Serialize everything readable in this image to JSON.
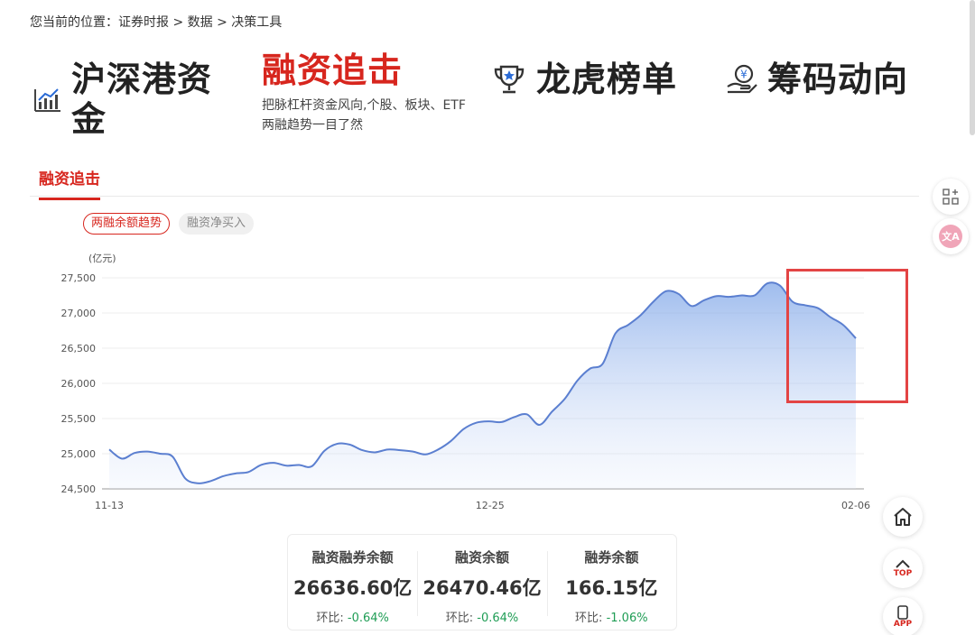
{
  "breadcrumb": "您当前的位置：证券时报 > 数据 > 决策工具",
  "tools": {
    "hk": {
      "title": "沪深港资金",
      "icon": "bar-line-icon"
    },
    "margin": {
      "title": "融资追击",
      "desc": "把脉杠杆资金风向,个股、板块、ETF两融趋势一目了然",
      "color": "#d7261e"
    },
    "dragon": {
      "title": "龙虎榜单",
      "icon": "trophy-icon"
    },
    "chip": {
      "title": "筹码动向",
      "icon": "hand-yen-icon"
    }
  },
  "tab": {
    "active": "融资追击"
  },
  "pills": {
    "active": "两融余额趋势",
    "inactive": "融资净买入"
  },
  "chart_data": {
    "type": "area",
    "unit_label": "(亿元)",
    "ylim": [
      24500,
      27500
    ],
    "yticks": [
      24500,
      25000,
      25500,
      26000,
      26500,
      27000,
      27500
    ],
    "ytick_labels": [
      "24,500",
      "25,000",
      "25,500",
      "26,000",
      "26,500",
      "27,000",
      "27,500"
    ],
    "xtick_labels": [
      "11-13",
      "12-25",
      "02-06"
    ],
    "line_color": "#5b7fd0",
    "grid": true,
    "series": [
      {
        "values": [
          25060,
          24930,
          25010,
          25030,
          25000,
          24960,
          24650,
          24580,
          24610,
          24680,
          24720,
          24740,
          24840,
          24870,
          24830,
          24840,
          24820,
          25040,
          25140,
          25130,
          25050,
          25020,
          25060,
          25050,
          25030,
          24990,
          25060,
          25180,
          25350,
          25440,
          25460,
          25450,
          25520,
          25560,
          25410,
          25600,
          25780,
          26040,
          26210,
          26280,
          26710,
          26830,
          26970,
          27160,
          27310,
          27270,
          27100,
          27180,
          27240,
          27230,
          27250,
          27250,
          27420,
          27390,
          27160,
          27110,
          27070,
          26940,
          26830,
          26640
        ]
      }
    ]
  },
  "stats": [
    {
      "label": "融资融券余额",
      "value": "26636.60亿",
      "change_label": "环比:",
      "change": "-0.64%"
    },
    {
      "label": "融资余额",
      "value": "26470.46亿",
      "change_label": "环比:",
      "change": "-0.64%"
    },
    {
      "label": "融券余额",
      "value": "166.15亿",
      "change_label": "环比:",
      "change": "-1.06%"
    }
  ],
  "float_buttons": {
    "top": "TOP",
    "app": "APP"
  },
  "colors": {
    "accent": "#d7261e",
    "down": "#1f9d55",
    "highlight": "#e34444"
  }
}
